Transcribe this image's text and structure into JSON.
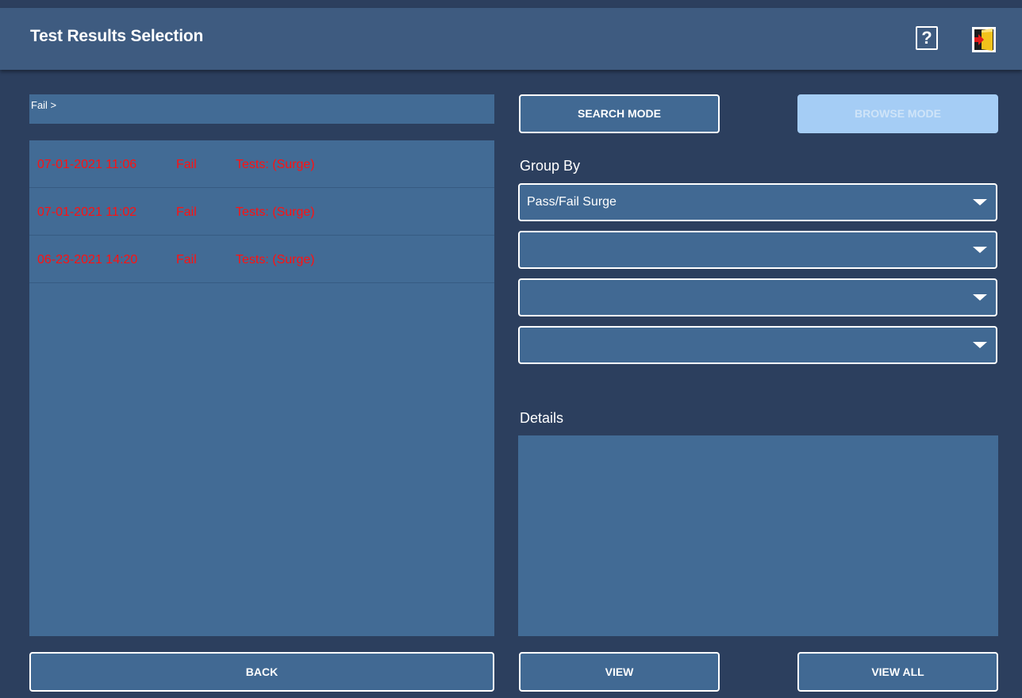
{
  "header": {
    "title": "Test Results Selection",
    "help_label": "?",
    "help_icon": "help-icon",
    "exit_icon": "exit-door-icon"
  },
  "breadcrumb": "Fail >",
  "results": [
    {
      "date": "07-01-2021 11:06",
      "result": "Fail",
      "tests": "Tests: (Surge)"
    },
    {
      "date": "07-01-2021 11:02",
      "result": "Fail",
      "tests": "Tests: (Surge)"
    },
    {
      "date": "06-23-2021 14:20",
      "result": "Fail",
      "tests": "Tests: (Surge)"
    }
  ],
  "modes": {
    "search_label": "SEARCH MODE",
    "browse_label": "BROWSE MODE"
  },
  "group_by": {
    "label": "Group By",
    "selects": [
      {
        "value": "Pass/Fail Surge"
      },
      {
        "value": ""
      },
      {
        "value": ""
      },
      {
        "value": ""
      }
    ]
  },
  "details": {
    "label": "Details",
    "content": ""
  },
  "actions": {
    "back_label": "BACK",
    "view_label": "VIEW",
    "view_all_label": "VIEW ALL"
  },
  "colors": {
    "background": "#2c3f5e",
    "panel": "#426b95",
    "fail_text": "#ff1111",
    "disabled_button": "#a5cdf5"
  }
}
